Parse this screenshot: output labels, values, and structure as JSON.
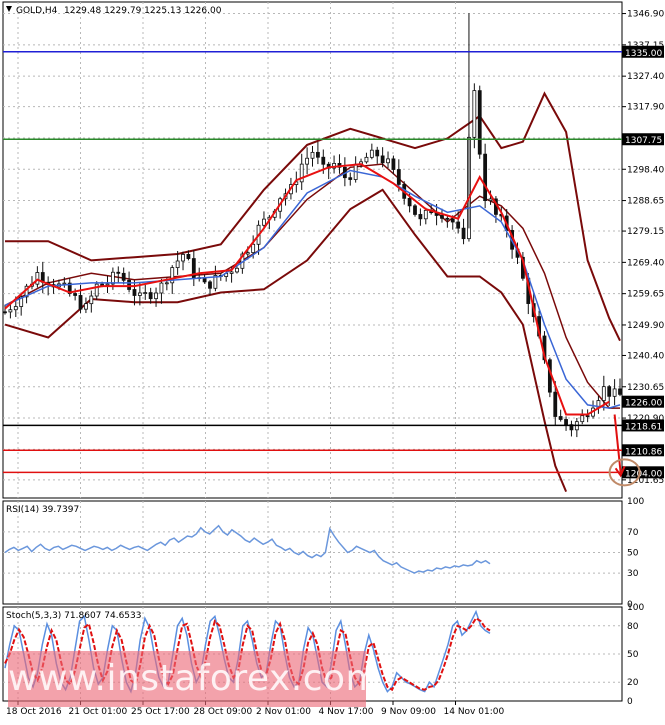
{
  "chart_data": [
    {
      "type": "candlestick",
      "symbol_label": "GOLD,H4",
      "ohlc_label": "1229.48 1229.79 1225.13 1226.00",
      "ylim": [
        1196.0,
        1350.5
      ],
      "y_ticks": [
        "1346.90",
        "1337.15",
        "1327.40",
        "1317.90",
        "1308.15",
        "1298.40",
        "1288.65",
        "1279.15",
        "1269.40",
        "1259.65",
        "1249.90",
        "1240.40",
        "1230.65",
        "1220.90",
        "1211.15",
        "1201.65"
      ],
      "x_ticks": [
        "18 Oct 2016",
        "21 Oct 01:00",
        "25 Oct 17:00",
        "28 Oct 09:00",
        "2 Nov 01:00",
        "4 Nov 17:00",
        "9 Nov 09:00",
        "14 Nov 01:00"
      ],
      "last_price": "1226.00",
      "levels": [
        {
          "label": "1335.00",
          "value": 1335.0,
          "color": "#1f1fd6"
        },
        {
          "label": "1307.75",
          "value": 1307.75,
          "color": "#2a8a2a"
        },
        {
          "label": "1218.61",
          "value": 1218.61,
          "color": "#000000"
        },
        {
          "label": "1210.86",
          "value": 1210.86,
          "color": "#e01010"
        },
        {
          "label": "1204.00",
          "value": 1204.0,
          "color": "#e01010"
        }
      ],
      "close_path": [
        [
          0,
          1254
        ],
        [
          3,
          1259
        ],
        [
          6,
          1266
        ],
        [
          9,
          1263
        ],
        [
          11,
          1261
        ],
        [
          13,
          1258
        ],
        [
          15,
          1255
        ],
        [
          17,
          1262
        ],
        [
          19,
          1263
        ],
        [
          21,
          1266
        ],
        [
          23,
          1262
        ],
        [
          25,
          1258
        ],
        [
          27,
          1260
        ],
        [
          29,
          1262
        ],
        [
          31,
          1268
        ],
        [
          33,
          1272
        ],
        [
          35,
          1266
        ],
        [
          37,
          1262
        ],
        [
          39,
          1264
        ],
        [
          41,
          1266
        ],
        [
          43,
          1269
        ],
        [
          45,
          1274
        ],
        [
          47,
          1280
        ],
        [
          49,
          1284
        ],
        [
          51,
          1290
        ],
        [
          53,
          1292
        ],
        [
          55,
          1300
        ],
        [
          57,
          1304
        ],
        [
          59,
          1298
        ],
        [
          61,
          1300
        ],
        [
          63,
          1296
        ],
        [
          65,
          1298
        ],
        [
          67,
          1302
        ],
        [
          69,
          1303
        ],
        [
          71,
          1300
        ],
        [
          73,
          1294
        ],
        [
          75,
          1288
        ],
        [
          77,
          1282
        ],
        [
          79,
          1286
        ],
        [
          81,
          1285
        ],
        [
          83,
          1282
        ],
        [
          85,
          1275
        ],
        [
          86,
          1310
        ],
        [
          87,
          1322
        ],
        [
          88,
          1304
        ],
        [
          89,
          1290
        ],
        [
          90,
          1288
        ],
        [
          91,
          1284
        ],
        [
          93,
          1280
        ],
        [
          95,
          1270
        ],
        [
          97,
          1258
        ],
        [
          99,
          1245
        ],
        [
          101,
          1230
        ],
        [
          102,
          1222
        ],
        [
          103,
          1220
        ],
        [
          105,
          1218
        ],
        [
          107,
          1221
        ],
        [
          109,
          1226
        ],
        [
          111,
          1230
        ],
        [
          113,
          1228
        ]
      ],
      "bands": {
        "upper": [
          [
            0,
            1276
          ],
          [
            8,
            1276
          ],
          [
            16,
            1270
          ],
          [
            24,
            1271
          ],
          [
            32,
            1272
          ],
          [
            40,
            1275
          ],
          [
            48,
            1292
          ],
          [
            56,
            1306
          ],
          [
            64,
            1311
          ],
          [
            70,
            1308
          ],
          [
            76,
            1305
          ],
          [
            82,
            1308
          ],
          [
            88,
            1315
          ],
          [
            92,
            1305
          ],
          [
            96,
            1307
          ],
          [
            100,
            1322
          ],
          [
            104,
            1310
          ],
          [
            108,
            1270
          ],
          [
            112,
            1252
          ],
          [
            114,
            1245
          ]
        ],
        "middle": [
          [
            0,
            1256
          ],
          [
            8,
            1263
          ],
          [
            16,
            1266
          ],
          [
            24,
            1264
          ],
          [
            32,
            1265
          ],
          [
            40,
            1266
          ],
          [
            48,
            1274
          ],
          [
            56,
            1289
          ],
          [
            64,
            1299
          ],
          [
            70,
            1300
          ],
          [
            76,
            1291
          ],
          [
            82,
            1282
          ],
          [
            88,
            1290
          ],
          [
            92,
            1287
          ],
          [
            96,
            1280
          ],
          [
            100,
            1266
          ],
          [
            104,
            1246
          ],
          [
            108,
            1232
          ],
          [
            112,
            1224
          ],
          [
            114,
            1224
          ]
        ],
        "lower": [
          [
            0,
            1250
          ],
          [
            8,
            1246
          ],
          [
            16,
            1258
          ],
          [
            24,
            1257
          ],
          [
            32,
            1257
          ],
          [
            40,
            1260
          ],
          [
            48,
            1261
          ],
          [
            56,
            1270
          ],
          [
            64,
            1286
          ],
          [
            70,
            1292
          ],
          [
            76,
            1278
          ],
          [
            82,
            1265
          ],
          [
            88,
            1265
          ],
          [
            92,
            1260
          ],
          [
            96,
            1250
          ],
          [
            100,
            1220
          ],
          [
            102,
            1206
          ],
          [
            104,
            1198
          ]
        ]
      },
      "ma_fast": [
        [
          0,
          1255
        ],
        [
          6,
          1264
        ],
        [
          12,
          1260
        ],
        [
          18,
          1262
        ],
        [
          24,
          1262
        ],
        [
          30,
          1264
        ],
        [
          36,
          1266
        ],
        [
          42,
          1267
        ],
        [
          48,
          1280
        ],
        [
          54,
          1295
        ],
        [
          60,
          1299
        ],
        [
          66,
          1300
        ],
        [
          72,
          1294
        ],
        [
          78,
          1286
        ],
        [
          84,
          1283
        ],
        [
          88,
          1296
        ],
        [
          92,
          1285
        ],
        [
          96,
          1270
        ],
        [
          100,
          1240
        ],
        [
          104,
          1222
        ],
        [
          108,
          1222
        ],
        [
          112,
          1226
        ]
      ],
      "ma_slow": [
        [
          0,
          1256
        ],
        [
          8,
          1262
        ],
        [
          16,
          1263
        ],
        [
          24,
          1263
        ],
        [
          32,
          1264
        ],
        [
          40,
          1265
        ],
        [
          48,
          1274
        ],
        [
          56,
          1291
        ],
        [
          64,
          1298
        ],
        [
          70,
          1296
        ],
        [
          76,
          1290
        ],
        [
          82,
          1285
        ],
        [
          88,
          1287
        ],
        [
          92,
          1282
        ],
        [
          96,
          1270
        ],
        [
          100,
          1250
        ],
        [
          104,
          1233
        ],
        [
          108,
          1225
        ],
        [
          112,
          1224
        ],
        [
          114,
          1225
        ]
      ],
      "candle_count": 115
    },
    {
      "type": "line",
      "label": "RSI(14) 39.7397",
      "ylim": [
        0,
        100
      ],
      "y_ticks": [
        "100",
        "70",
        "50",
        "30",
        "0"
      ],
      "guide_levels": [
        70,
        30
      ],
      "values": [
        50,
        53,
        55,
        52,
        54,
        56,
        51,
        55,
        58,
        54,
        52,
        55,
        56,
        53,
        55,
        57,
        56,
        54,
        52,
        54,
        56,
        55,
        53,
        55,
        52,
        54,
        57,
        55,
        53,
        55,
        56,
        54,
        52,
        55,
        58,
        60,
        57,
        62,
        64,
        60,
        63,
        66,
        65,
        68,
        74,
        70,
        68,
        72,
        76,
        70,
        67,
        72,
        69,
        66,
        62,
        60,
        64,
        61,
        58,
        60,
        63,
        57,
        55,
        52,
        54,
        50,
        48,
        51,
        47,
        45,
        48,
        46,
        50,
        73,
        66,
        60,
        55,
        50,
        52,
        56,
        54,
        52,
        50,
        52,
        46,
        42,
        40,
        38,
        40,
        36,
        34,
        32,
        30,
        32,
        31,
        33,
        32,
        35,
        34,
        36,
        35,
        37,
        36,
        38,
        37,
        38,
        42,
        40,
        42,
        39
      ]
    },
    {
      "type": "line",
      "label": "Stoch(5,3,3) 71.8607 74.6533",
      "ylim": [
        0,
        100
      ],
      "y_ticks": [
        "100",
        "80",
        "50",
        "20",
        "0"
      ],
      "guide_levels": [
        80,
        20
      ],
      "k": [
        35,
        60,
        80,
        75,
        50,
        25,
        15,
        30,
        60,
        82,
        70,
        40,
        20,
        12,
        25,
        55,
        85,
        90,
        65,
        35,
        18,
        25,
        55,
        80,
        75,
        45,
        20,
        10,
        30,
        65,
        88,
        78,
        50,
        25,
        15,
        20,
        50,
        80,
        88,
        70,
        40,
        20,
        30,
        60,
        85,
        90,
        70,
        45,
        25,
        20,
        45,
        80,
        85,
        65,
        40,
        25,
        30,
        60,
        85,
        80,
        50,
        25,
        15,
        20,
        55,
        78,
        70,
        45,
        20,
        15,
        40,
        75,
        85,
        60,
        30,
        15,
        20,
        50,
        70,
        55,
        35,
        20,
        10,
        15,
        30,
        25,
        20,
        18,
        15,
        12,
        10,
        20,
        15,
        30,
        45,
        60,
        80,
        85,
        70,
        75,
        85,
        95,
        80,
        75,
        72
      ],
      "d": [
        40,
        50,
        65,
        76,
        68,
        50,
        30,
        22,
        35,
        58,
        75,
        65,
        42,
        22,
        18,
        32,
        55,
        78,
        82,
        62,
        38,
        22,
        32,
        58,
        75,
        65,
        42,
        22,
        18,
        38,
        68,
        80,
        70,
        45,
        25,
        18,
        28,
        55,
        80,
        82,
        62,
        38,
        26,
        42,
        68,
        85,
        80,
        60,
        38,
        25,
        32,
        60,
        80,
        75,
        52,
        32,
        28,
        45,
        72,
        82,
        65,
        38,
        22,
        18,
        35,
        62,
        72,
        60,
        35,
        20,
        25,
        52,
        75,
        72,
        48,
        25,
        18,
        32,
        58,
        62,
        45,
        28,
        15,
        12,
        22,
        25,
        22,
        19,
        16,
        13,
        12,
        15,
        16,
        22,
        35,
        50,
        68,
        80,
        78,
        75,
        80,
        88,
        85,
        78,
        75
      ]
    }
  ],
  "watermark": {
    "text": "www.instaforex.com"
  },
  "colors": {
    "price_candles": "#111111",
    "upper_lower_band": "#7a0a0a",
    "ma_fast": "#e81010",
    "ma_slow": "#3a66d6",
    "rsi": "#6b97dc",
    "stoch_main": "#5b8fe0",
    "stoch_signal": "#e01010",
    "label_bg": "#000000",
    "label_text": "#ffffff"
  }
}
